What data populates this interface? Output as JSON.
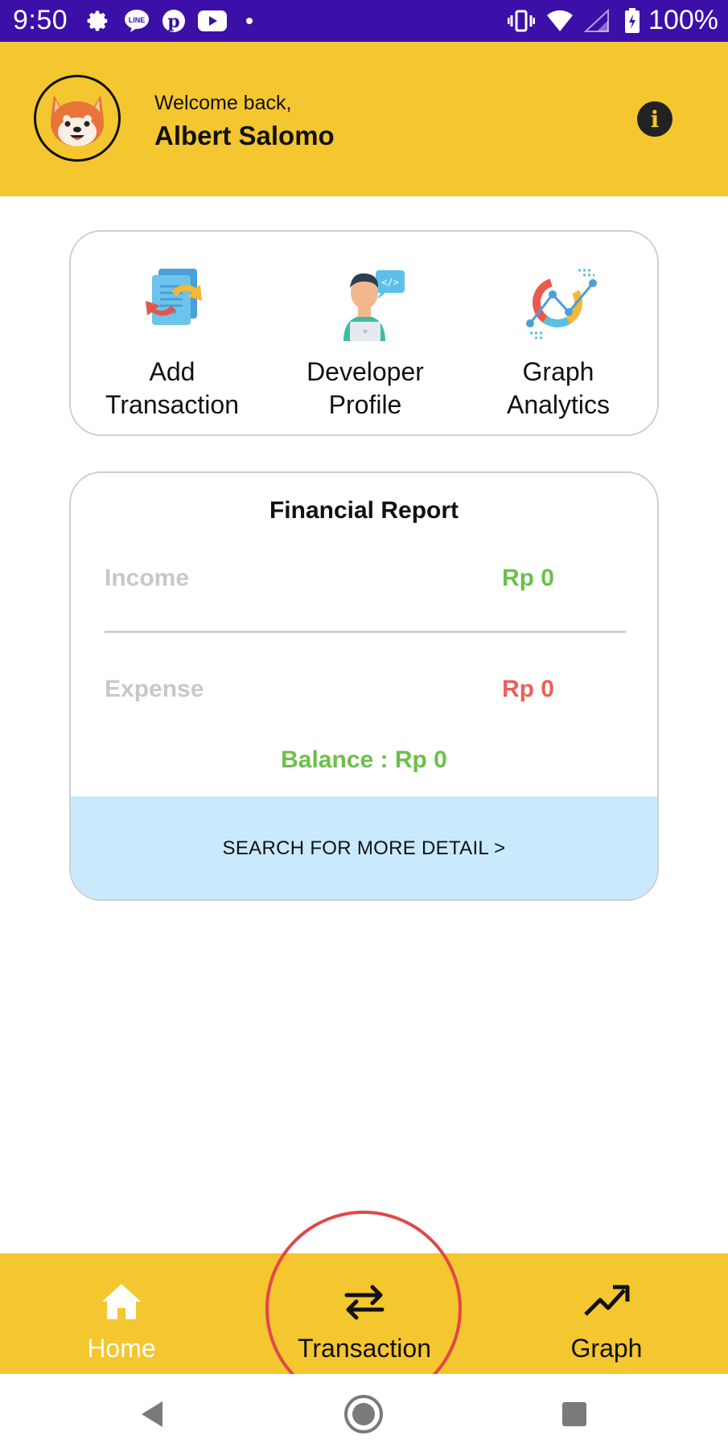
{
  "status_bar": {
    "time": "9:50",
    "battery": "100%",
    "icons": [
      "settings-icon",
      "line-icon",
      "pinterest-icon",
      "youtube-icon",
      "dot-icon",
      "vibrate-icon",
      "wifi-icon",
      "signal-icon",
      "battery-icon"
    ]
  },
  "header": {
    "welcome": "Welcome back,",
    "username": "Albert Salomo",
    "info_icon": "i"
  },
  "menu": {
    "items": [
      {
        "line1": "Add",
        "line2": "Transaction",
        "icon": "add-transaction-icon"
      },
      {
        "line1": "Developer",
        "line2": "Profile",
        "icon": "developer-profile-icon"
      },
      {
        "line1": "Graph",
        "line2": "Analytics",
        "icon": "graph-analytics-icon"
      }
    ]
  },
  "report": {
    "title": "Financial Report",
    "income_label": "Income",
    "income_value": "Rp 0",
    "expense_label": "Expense",
    "expense_value": "Rp 0",
    "balance": "Balance : Rp 0",
    "search_more": "SEARCH FOR MORE DETAIL >"
  },
  "bottom_nav": {
    "items": [
      {
        "label": "Home",
        "icon": "home-icon"
      },
      {
        "label": "Transaction",
        "icon": "swap-arrows-icon"
      },
      {
        "label": "Graph",
        "icon": "trending-up-icon"
      }
    ],
    "active": "Home"
  },
  "colors": {
    "status_bar": "#3b0fa8",
    "header": "#f4c62f",
    "income": "#6cc04a",
    "expense": "#ec5f5a",
    "balance": "#6cc04a",
    "search_bg": "#c9eafc",
    "highlight": "#e04848"
  }
}
